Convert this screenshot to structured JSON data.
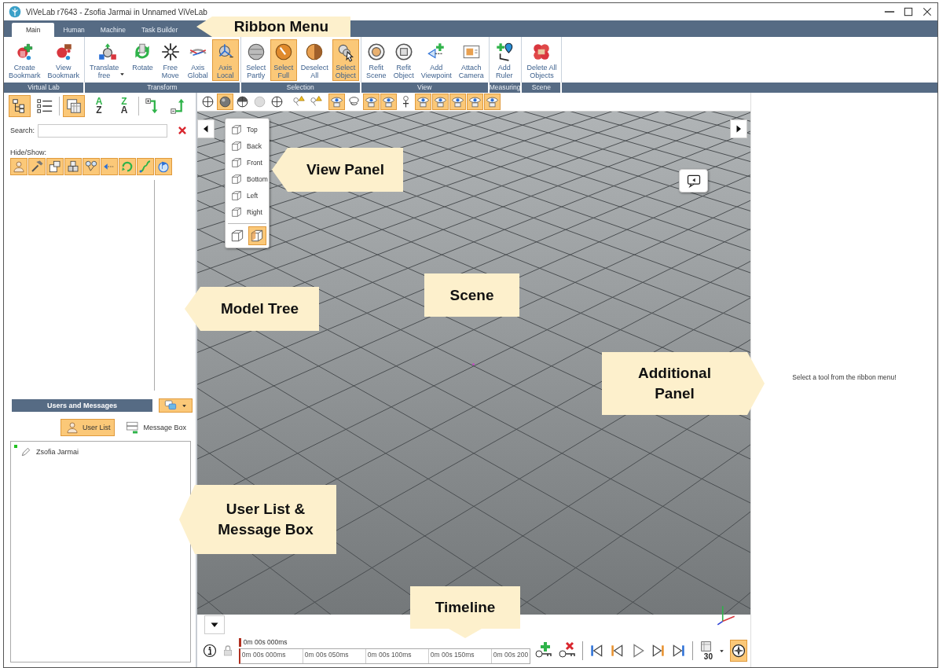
{
  "window": {
    "title": "ViVeLab r7643 - Zsofia Jarmai in Unnamed ViVeLab"
  },
  "ribbon": {
    "tabs": [
      {
        "label": "Main",
        "selected": true
      },
      {
        "label": "Human",
        "selected": false
      },
      {
        "label": "Machine",
        "selected": false
      },
      {
        "label": "Task Builder",
        "selected": false
      }
    ],
    "groups": [
      {
        "label": "Virtual Lab",
        "buttons": [
          {
            "label": "Create\nBookmark",
            "selected": false,
            "dropdown": false
          },
          {
            "label": "View\nBookmark",
            "selected": false,
            "dropdown": false
          }
        ]
      },
      {
        "label": "Transform",
        "buttons": [
          {
            "label": "Translate\nfree",
            "selected": false,
            "dropdown": true
          },
          {
            "label": "Rotate",
            "selected": false,
            "dropdown": false
          },
          {
            "label": "Free\nMove",
            "selected": false,
            "dropdown": false
          },
          {
            "label": "Axis\nGlobal",
            "selected": false,
            "dropdown": false
          },
          {
            "label": "Axis\nLocal",
            "selected": true,
            "dropdown": false
          }
        ]
      },
      {
        "label": "Selection",
        "buttons": [
          {
            "label": "Select\nPartly",
            "selected": false,
            "dropdown": false
          },
          {
            "label": "Select\nFull",
            "selected": true,
            "dropdown": false
          },
          {
            "label": "Deselect\nAll",
            "selected": false,
            "dropdown": false
          },
          {
            "label": "Select\nObject",
            "selected": true,
            "dropdown": false
          }
        ]
      },
      {
        "label": "View",
        "buttons": [
          {
            "label": "Refit\nScene",
            "selected": false,
            "dropdown": false
          },
          {
            "label": "Refit\nObject",
            "selected": false,
            "dropdown": false
          },
          {
            "label": "Add\nViewpoint",
            "selected": false,
            "dropdown": false
          },
          {
            "label": "Attach\nCamera",
            "selected": false,
            "dropdown": false
          }
        ]
      },
      {
        "label": "Measuring",
        "buttons": [
          {
            "label": "Add\nRuler",
            "selected": false,
            "dropdown": false
          }
        ]
      },
      {
        "label": "Scene",
        "buttons": [
          {
            "label": "Delete All\nObjects",
            "selected": false,
            "dropdown": false
          }
        ]
      }
    ]
  },
  "model_tree": {
    "toolbar": [
      {
        "kind": "icon",
        "selected": true
      },
      {
        "kind": "icon",
        "selected": false
      },
      {
        "kind": "icon",
        "selected": true
      },
      {
        "kind": "sort",
        "top": "A",
        "bottom": "Z",
        "selected": false
      },
      {
        "kind": "sort",
        "top": "Z",
        "bottom": "A",
        "selected": false
      },
      {
        "kind": "icon",
        "selected": false
      },
      {
        "kind": "icon",
        "selected": false
      }
    ],
    "search": {
      "label": "Search:"
    },
    "hide_show": {
      "label": "Hide/Show:",
      "buttons": [
        {
          "selected": true
        },
        {
          "selected": true
        },
        {
          "selected": true
        },
        {
          "selected": true
        },
        {
          "selected": true
        },
        {
          "selected": true
        },
        {
          "selected": true
        },
        {
          "selected": true
        },
        {
          "selected": true
        }
      ]
    }
  },
  "users": {
    "title": "Users and Messages",
    "tabs": [
      {
        "label": "User List",
        "selected": true
      },
      {
        "label": "Message Box",
        "selected": false
      }
    ],
    "list": [
      {
        "name": "Zsofia Jarmai",
        "online": true
      }
    ]
  },
  "scene": {
    "toolbar": [
      {
        "selected": false
      },
      {
        "selected": true
      },
      {
        "selected": false
      },
      {
        "selected": false
      },
      {
        "selected": false
      },
      {
        "selected": false
      },
      {
        "selected": false
      },
      {
        "selected": true
      },
      {
        "selected": false
      },
      {
        "selected": true
      },
      {
        "selected": true
      },
      {
        "selected": false
      },
      {
        "selected": true
      },
      {
        "selected": true
      },
      {
        "selected": true
      },
      {
        "selected": true
      },
      {
        "selected": true
      }
    ],
    "view_panel": {
      "items": [
        {
          "label": "Top"
        },
        {
          "label": "Back"
        },
        {
          "label": "Front"
        },
        {
          "label": "Bottom"
        },
        {
          "label": "Left"
        },
        {
          "label": "Right"
        }
      ],
      "modes": [
        {
          "selected": false
        },
        {
          "selected": true
        }
      ]
    }
  },
  "side_panel": {
    "message": "Select a tool from the ribbon menu!"
  },
  "timeline": {
    "current": "0m 00s 000ms",
    "ticks": [
      "0m 00s 000ms",
      "0m 00s 050ms",
      "0m 00s 100ms",
      "0m 00s 150ms",
      "0m 00s 200"
    ],
    "controls": [
      {
        "selected": false
      },
      {
        "selected": false
      },
      {
        "selected": false
      },
      {
        "selected": false
      },
      {
        "selected": false
      },
      {
        "selected": false
      },
      {
        "selected": false
      }
    ],
    "fps": "30",
    "compass": {
      "selected": true
    }
  },
  "annotations": [
    {
      "label": "Ribbon Menu",
      "kind": "left"
    },
    {
      "label": "View Panel",
      "kind": "left"
    },
    {
      "label": "Model Tree",
      "kind": "left"
    },
    {
      "label": "Scene",
      "kind": "plain"
    },
    {
      "label": "Additional\nPanel",
      "kind": "right"
    },
    {
      "label": "User List &\nMessage Box",
      "kind": "left"
    },
    {
      "label": "Timeline",
      "kind": "down"
    }
  ]
}
